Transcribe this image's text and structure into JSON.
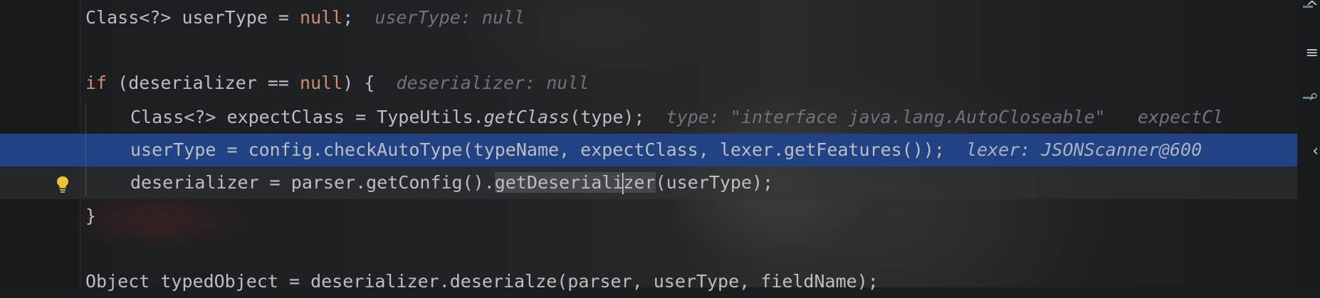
{
  "editor": {
    "lines": [
      {
        "segments": [
          {
            "text": "Class<?> userType = ",
            "cls": ""
          },
          {
            "text": "null",
            "cls": "kw"
          },
          {
            "text": ";  ",
            "cls": ""
          },
          {
            "text": "userType: null",
            "cls": "hint"
          }
        ]
      },
      {
        "segments": []
      },
      {
        "segments": [
          {
            "text": "if",
            "cls": "kw"
          },
          {
            "text": " (deserializer == ",
            "cls": ""
          },
          {
            "text": "null",
            "cls": "kw"
          },
          {
            "text": ") {  ",
            "cls": ""
          },
          {
            "text": "deserializer: null",
            "cls": "hint"
          }
        ]
      },
      {
        "segments": [
          {
            "text": "Class<?> expectClass = TypeUtils.",
            "cls": ""
          },
          {
            "text": "getClass",
            "cls": "method-italic"
          },
          {
            "text": "(type);  ",
            "cls": ""
          },
          {
            "text": "type: \"interface java.lang.AutoCloseable\"   expectCl",
            "cls": "hint"
          }
        ]
      },
      {
        "segments": [
          {
            "text": "userType = config.checkAutoType(typeName, expectClass, lexer.getFeatures());  ",
            "cls": ""
          },
          {
            "text": "lexer: JSONScanner@600",
            "cls": "hint"
          }
        ]
      },
      {
        "segments": [
          {
            "text": "deserializer = parser.getConfig().",
            "cls": ""
          },
          {
            "text": "getDeseriali",
            "cls": "hl-occurrence"
          },
          {
            "text": "|",
            "cls": "caret"
          },
          {
            "text": "zer",
            "cls": "hl-occurrence"
          },
          {
            "text": "(userType);",
            "cls": ""
          }
        ]
      },
      {
        "segments": [
          {
            "text": "}",
            "cls": ""
          }
        ]
      },
      {
        "segments": []
      },
      {
        "segments": [
          {
            "text": "Object typedObject = deserializer.deserialze(parser, userType, fieldName);",
            "cls": ""
          }
        ]
      }
    ]
  },
  "colors": {
    "selection": "#214283",
    "keyword": "#cf8e6d",
    "hint": "#6f737a",
    "bulb": "#e8c33b"
  },
  "icons": {
    "gutter": "lightbulb-icon"
  }
}
